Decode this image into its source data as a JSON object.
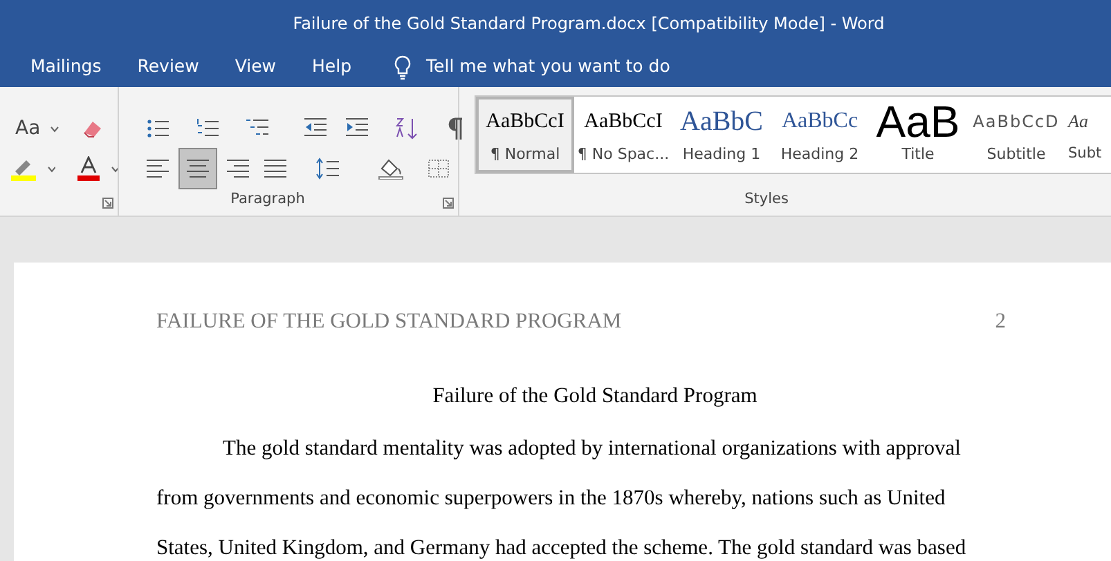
{
  "window": {
    "title": "Failure of the Gold Standard Program.docx [Compatibility Mode]  -  Word"
  },
  "menu_tabs": [
    {
      "label": "Mailings"
    },
    {
      "label": "Review"
    },
    {
      "label": "View"
    },
    {
      "label": "Help"
    }
  ],
  "tell_me": {
    "placeholder": "Tell me what you want to do"
  },
  "font_group": {
    "change_case": "Aa"
  },
  "paragraph_group": {
    "label": "Paragraph",
    "alignment_buttons": [
      {
        "kind": "left",
        "selected": false
      },
      {
        "kind": "center",
        "selected": true
      },
      {
        "kind": "right",
        "selected": false
      },
      {
        "kind": "justify",
        "selected": false
      }
    ]
  },
  "styles_group": {
    "label": "Styles",
    "items": [
      {
        "kind": "normal",
        "preview": "AaBbCcI",
        "name": "¶ Normal",
        "selected": true
      },
      {
        "kind": "normal",
        "preview": "AaBbCcI",
        "name": "¶ No Spac...",
        "selected": false
      },
      {
        "kind": "heading1",
        "preview": "AaBbC",
        "name": "Heading 1",
        "selected": false
      },
      {
        "kind": "heading2",
        "preview": "AaBbCc",
        "name": "Heading 2",
        "selected": false
      },
      {
        "kind": "title",
        "preview": "AaB",
        "name": "Title",
        "selected": false
      },
      {
        "kind": "subtitle",
        "preview": "AaBbCcD",
        "name": "Subtitle",
        "selected": false
      },
      {
        "kind": "emphasis",
        "preview": "Aa",
        "name": "Subt",
        "selected": false
      }
    ]
  },
  "document": {
    "header": "FAILURE OF THE GOLD STANDARD PROGRAM",
    "page_number": "2",
    "title": "Failure of the Gold Standard Program",
    "lines": [
      "The gold standard mentality was adopted by international organizations with approval",
      "from governments and economic superpowers in the 1870s whereby, nations such as United",
      "States, United Kingdom, and Germany had accepted the scheme. The gold standard was based"
    ]
  }
}
